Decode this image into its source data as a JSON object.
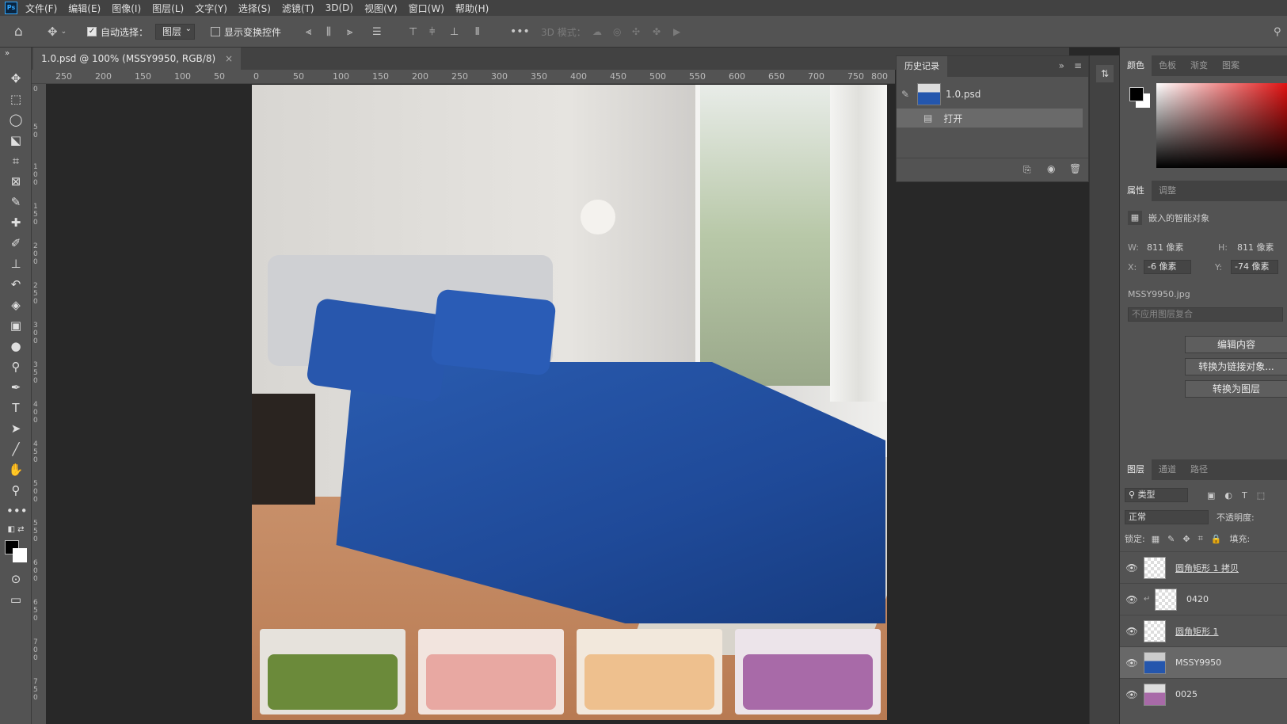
{
  "menubar": {
    "logo": "Ps",
    "items": [
      "文件(F)",
      "编辑(E)",
      "图像(I)",
      "图层(L)",
      "文字(Y)",
      "选择(S)",
      "滤镜(T)",
      "3D(D)",
      "视图(V)",
      "窗口(W)",
      "帮助(H)"
    ]
  },
  "options": {
    "auto_select_label": "自动选择：",
    "auto_select_value": "图层",
    "transform_label": "显示变换控件",
    "mode3d_label": "3D 模式："
  },
  "document": {
    "tab_title": "1.0.psd @ 100% (MSSY9950, RGB/8)",
    "close": "×"
  },
  "rulers": {
    "h_ticks": [
      "250",
      "200",
      "150",
      "100",
      "50",
      "0",
      "50",
      "100",
      "150",
      "200",
      "250",
      "300",
      "350",
      "400",
      "450",
      "500",
      "550",
      "600",
      "650",
      "700",
      "750",
      "800"
    ],
    "v_ticks": [
      "0",
      "5 0",
      "1 0 0",
      "1 5 0",
      "2 0 0",
      "2 5 0",
      "3 0 0",
      "3 5 0",
      "4 0 0",
      "4 5 0",
      "5 0 0",
      "5 5 0",
      "6 0 0",
      "6 5 0",
      "7 0 0",
      "7 5 0"
    ]
  },
  "history": {
    "tab": "历史记录",
    "items": [
      {
        "label": "1.0.psd"
      },
      {
        "label": "打开"
      }
    ]
  },
  "color_panel": {
    "tabs": [
      "颜色",
      "色板",
      "渐变",
      "图案"
    ],
    "fg": "#000000",
    "bg": "#ffffff"
  },
  "properties": {
    "tabs": [
      "属性",
      "调整"
    ],
    "type": "嵌入的智能对象",
    "w_label": "W:",
    "w_value": "811 像素",
    "h_label": "H:",
    "h_value": "811 像素",
    "x_label": "X:",
    "x_value": "-6 像素",
    "y_label": "Y:",
    "y_value": "-74 像素",
    "filename": "MSSY9950.jpg",
    "comp_placeholder": "不应用图层复合",
    "buttons": [
      "编辑内容",
      "转换为链接对象...",
      "转换为图层"
    ]
  },
  "layers": {
    "tabs": [
      "图层",
      "通道",
      "路径"
    ],
    "filter_label": "类型",
    "blend_mode": "正常",
    "opacity_label": "不透明度:",
    "lock_label": "锁定:",
    "fill_label": "填充:",
    "items": [
      {
        "name": "圆角矩形 1 拷贝"
      },
      {
        "name": "0420"
      },
      {
        "name": "圆角矩形 1"
      },
      {
        "name": "MSSY9950"
      },
      {
        "name": "0025"
      }
    ]
  },
  "colors": {
    "bedding_blue": "#2456ad",
    "thumb_green": "#6b8a3a",
    "thumb_pink": "#e8a8a2",
    "thumb_peach": "#eec08e",
    "thumb_purple": "#a86aa8"
  }
}
